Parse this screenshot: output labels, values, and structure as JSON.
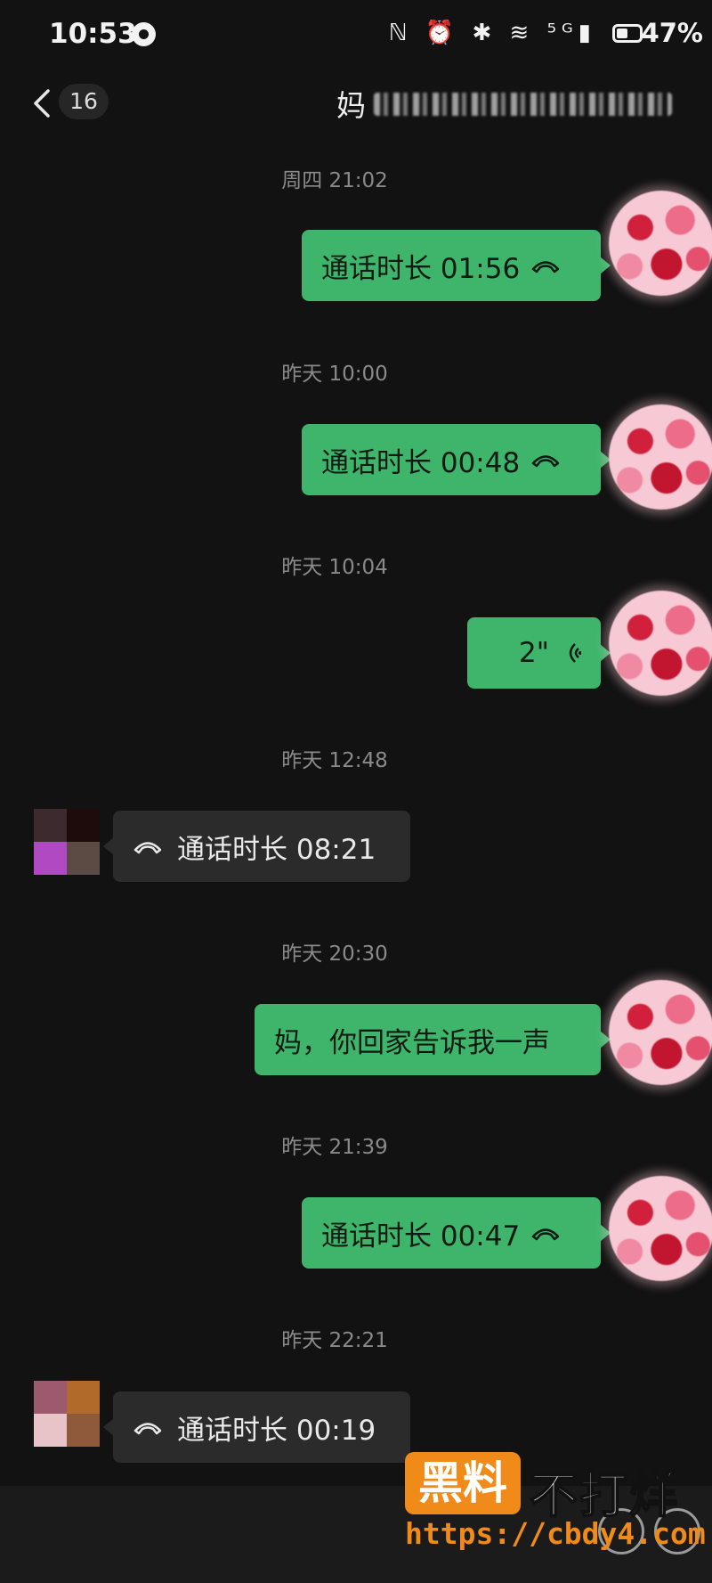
{
  "status_bar": {
    "time": "10:53",
    "icons": "ℕ ⏰ ✱ ≋ ⁵ᴳ▮",
    "battery": "47%"
  },
  "header": {
    "unread_count": "16",
    "title": "妈"
  },
  "messages": [
    {
      "timestamp": "周四 21:02",
      "side": "out",
      "type": "call",
      "text": "通话时长 01:56"
    },
    {
      "timestamp": "昨天 10:00",
      "side": "out",
      "type": "call",
      "text": "通话时长 00:48"
    },
    {
      "timestamp": "昨天 10:04",
      "side": "out",
      "type": "voice",
      "text": "2\""
    },
    {
      "timestamp": "昨天 12:48",
      "side": "in",
      "type": "call",
      "text": "通话时长 08:21"
    },
    {
      "timestamp": "昨天 20:30",
      "side": "out",
      "type": "text",
      "text": "妈，你回家告诉我一声"
    },
    {
      "timestamp": "昨天 21:39",
      "side": "out",
      "type": "call",
      "text": "通话时长 00:47"
    },
    {
      "timestamp": "昨天 22:21",
      "side": "in",
      "type": "call",
      "text": "通话时长 00:19"
    }
  ],
  "watermark": {
    "box_text": "黑料",
    "text": "不打烊",
    "url": "https://cbdy4.com"
  },
  "colors": {
    "outgoing_bubble": "#3eb56b",
    "incoming_bubble": "#2b2b2b",
    "background": "#121212",
    "watermark_orange": "#f08a18"
  }
}
